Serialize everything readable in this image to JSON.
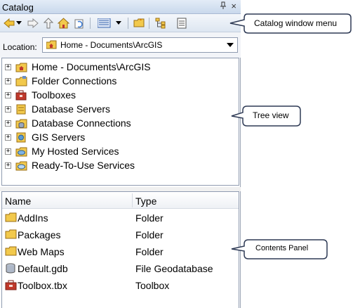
{
  "window": {
    "title": "Catalog",
    "pin_glyph": "ᵖ",
    "close_glyph": "×"
  },
  "toolbar": {
    "buttons": [
      "back-icon",
      "dropdown-arrow-icon",
      "forward-icon",
      "up-level-icon",
      "home-icon",
      "refresh-icon",
      "views-icon",
      "views-dropdown-icon",
      "connect-folder-icon",
      "tree-toggle-icon",
      "options-icon"
    ]
  },
  "location": {
    "label": "Location:",
    "value": "Home - Documents\\ArcGIS"
  },
  "tree": {
    "items": [
      {
        "label": "Home - Documents\\ArcGIS",
        "icon": "home-folder-icon"
      },
      {
        "label": "Folder Connections",
        "icon": "folder-connections-icon"
      },
      {
        "label": "Toolboxes",
        "icon": "toolboxes-icon"
      },
      {
        "label": "Database Servers",
        "icon": "database-servers-icon"
      },
      {
        "label": "Database Connections",
        "icon": "database-connections-icon"
      },
      {
        "label": "GIS Servers",
        "icon": "gis-servers-icon"
      },
      {
        "label": "My Hosted Services",
        "icon": "hosted-services-icon"
      },
      {
        "label": "Ready-To-Use Services",
        "icon": "ready-services-icon"
      }
    ]
  },
  "contents": {
    "columns": {
      "name": "Name",
      "type": "Type"
    },
    "rows": [
      {
        "name": "AddIns",
        "type": "Folder",
        "icon": "folder-icon"
      },
      {
        "name": "Packages",
        "type": "Folder",
        "icon": "folder-icon"
      },
      {
        "name": "Web Maps",
        "type": "Folder",
        "icon": "folder-icon"
      },
      {
        "name": "Default.gdb",
        "type": "File Geodatabase",
        "icon": "geodatabase-icon"
      },
      {
        "name": "Toolbox.tbx",
        "type": "Toolbox",
        "icon": "toolbox-icon"
      }
    ]
  },
  "callouts": {
    "menu": "Catalog window menu",
    "tree": "Tree view",
    "contents": "Contents Panel"
  },
  "colors": {
    "folder": "#f2c94c",
    "folder_dark": "#c9932c",
    "toolbox": "#c0392b",
    "accent": "#4a6fa5"
  }
}
